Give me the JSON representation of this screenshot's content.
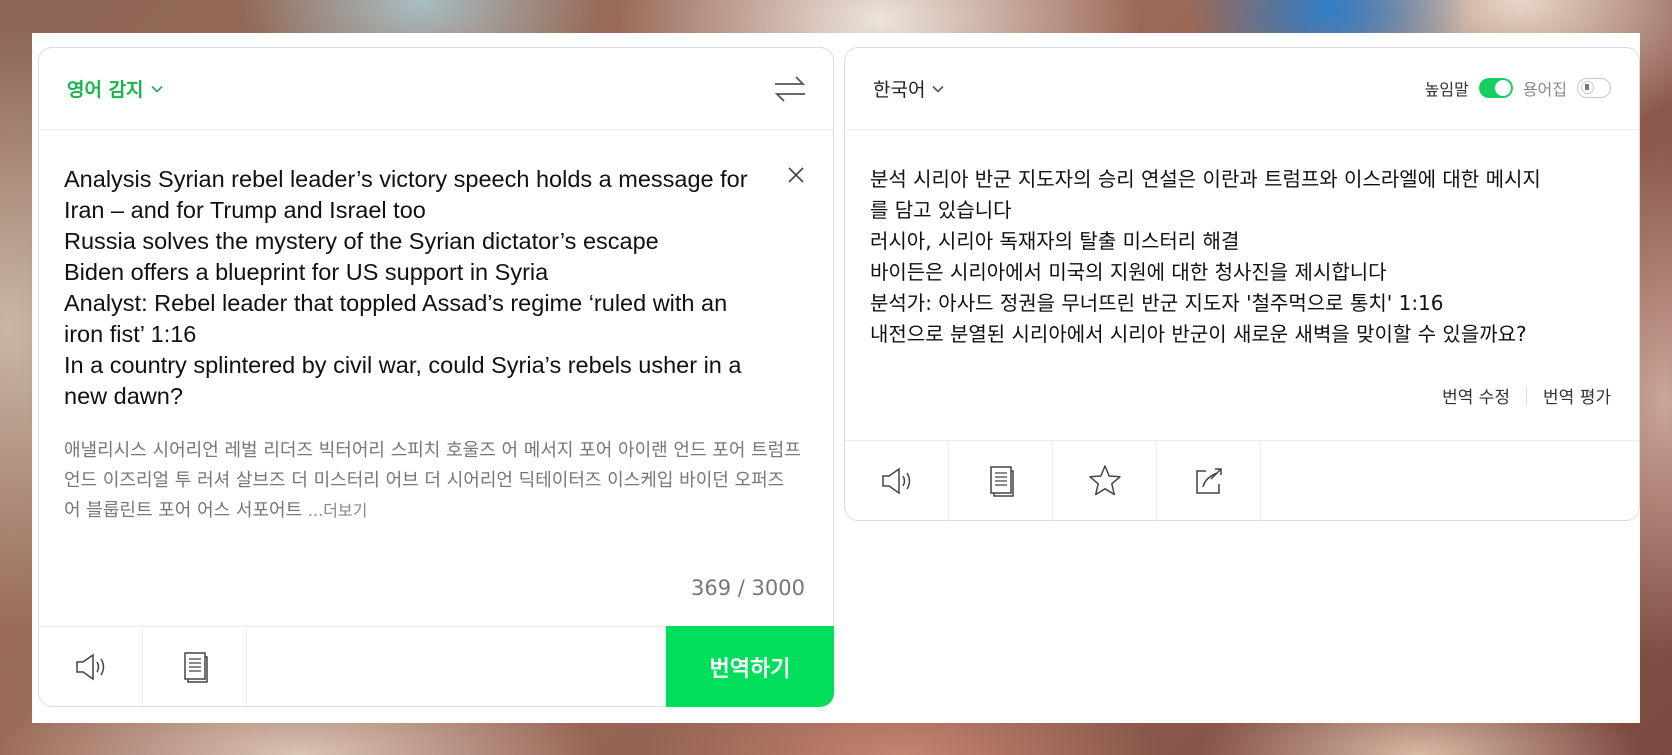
{
  "source": {
    "language_label": "영어 감지",
    "text": "Analysis Syrian rebel leader’s victory speech holds a message for\nIran – and for Trump and Israel too\nRussia solves the mystery of the Syrian dictator’s escape\nBiden offers a blueprint for US support in Syria\nAnalyst: Rebel leader that toppled Assad’s regime ‘ruled with an\niron fist’ 1:16\nIn a country splintered by civil war, could Syria’s rebels usher in a\nnew dawn?",
    "pronunciation": "애낼리시스 시어리언 레벌 리더즈 빅터어리 스피치 호울즈 어 메서지 포어 아이랜 언드 포어 트럼프 언드 이즈리얼 투 러셔 살브즈 더 미스터리 어브 더 시어리언 딕테이터즈 이스케입 바이던 오퍼즈 어 블룹린트 포어 어스 서포어트 ",
    "more_label": "...더보기",
    "counter": "369 / 3000",
    "translate_label": "번역하기"
  },
  "target": {
    "language_label": "한국어",
    "honorific_label": "높임말",
    "glossary_label": "용어집",
    "text": "분석 시리아 반군 지도자의 승리 연설은 이란과 트럼프와 이스라엘에 대한 메시지\n를 담고 있습니다\n러시아, 시리아 독재자의 탈출 미스터리 해결\n바이든은 시리아에서 미국의 지원에 대한 청사진을 제시합니다\n분석가: 아사드 정권을 무너뜨린 반군 지도자 '철주먹으로 통치' 1:16\n내전으로 분열된 시리아에서 시리아 반군이 새로운 새벽을 맞이할 수 있을까요?",
    "edit_label": "번역 수정",
    "rate_label": "번역 평가"
  },
  "colors": {
    "accent_green": "#00de5c",
    "label_green": "#1bb34d"
  },
  "icons": [
    "chevron-down-icon",
    "swap-icon",
    "close-icon",
    "speaker-icon",
    "copy-icon",
    "star-icon",
    "share-icon"
  ]
}
